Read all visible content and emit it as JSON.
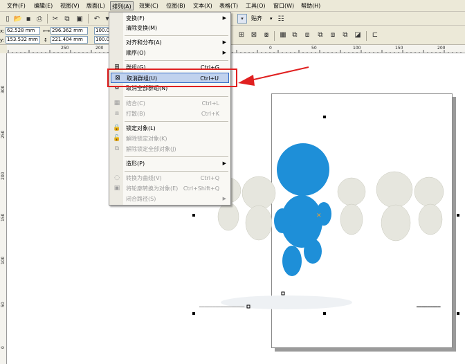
{
  "menubar": {
    "items": [
      {
        "label": "文件(F)",
        "id": "file"
      },
      {
        "label": "编辑(E)",
        "id": "edit"
      },
      {
        "label": "视图(V)",
        "id": "view"
      },
      {
        "label": "版面(L)",
        "id": "layout"
      },
      {
        "label": "排列(A)",
        "id": "arrange"
      },
      {
        "label": "效果(C)",
        "id": "effects"
      },
      {
        "label": "位图(B)",
        "id": "bitmaps"
      },
      {
        "label": "文本(X)",
        "id": "text"
      },
      {
        "label": "表格(T)",
        "id": "table"
      },
      {
        "label": "工具(O)",
        "id": "tools"
      },
      {
        "label": "窗口(W)",
        "id": "window"
      },
      {
        "label": "帮助(H)",
        "id": "help"
      }
    ]
  },
  "toolbar": {
    "snap_label": "贴齐"
  },
  "properties": {
    "x_label": "x:",
    "x_value": "62.528 mm",
    "y_label": "y:",
    "y_value": "153.532 mm",
    "width_value": "296.362 mm",
    "height_value": "221.404 mm",
    "scale_x": "100.0",
    "scale_y": "100.0"
  },
  "ruler": {
    "top_ticks": [
      "250",
      "200",
      "0",
      "50",
      "100",
      "150",
      "200"
    ],
    "left_ticks": [
      "300",
      "250",
      "200",
      "150",
      "100",
      "50",
      "0"
    ]
  },
  "arrange_menu": {
    "items": [
      {
        "label": "变换(F)",
        "shortcut": "",
        "submenu": true,
        "disabled": false,
        "icon": ""
      },
      {
        "label": "清除变换(M)",
        "shortcut": "",
        "submenu": false,
        "disabled": false,
        "icon": ""
      },
      {
        "label": "对齐和分布(A)",
        "shortcut": "",
        "submenu": true,
        "disabled": false,
        "icon": ""
      },
      {
        "label": "顺序(O)",
        "shortcut": "",
        "submenu": true,
        "disabled": false,
        "icon": ""
      },
      {
        "label": "群组(G)",
        "shortcut": "Ctrl+G",
        "submenu": false,
        "disabled": false,
        "icon": "group-icon"
      },
      {
        "label": "取消群组(U)",
        "shortcut": "Ctrl+U",
        "submenu": false,
        "disabled": false,
        "icon": "ungroup-icon"
      },
      {
        "label": "取消全部群组(N)",
        "shortcut": "",
        "submenu": false,
        "disabled": false,
        "icon": "ungroup-all-icon"
      },
      {
        "label": "结合(C)",
        "shortcut": "Ctrl+L",
        "submenu": false,
        "disabled": true,
        "icon": "combine-icon"
      },
      {
        "label": "打散(B)",
        "shortcut": "Ctrl+K",
        "submenu": false,
        "disabled": true,
        "icon": "break-apart-icon"
      },
      {
        "label": "锁定对象(L)",
        "shortcut": "",
        "submenu": false,
        "disabled": false,
        "icon": "lock-icon"
      },
      {
        "label": "解除锁定对象(K)",
        "shortcut": "",
        "submenu": false,
        "disabled": true,
        "icon": "unlock-icon"
      },
      {
        "label": "解除锁定全部对象(J)",
        "shortcut": "",
        "submenu": false,
        "disabled": true,
        "icon": "unlock-all-icon"
      },
      {
        "label": "造形(P)",
        "shortcut": "",
        "submenu": true,
        "disabled": false,
        "icon": ""
      },
      {
        "label": "转换为曲线(V)",
        "shortcut": "Ctrl+Q",
        "submenu": false,
        "disabled": true,
        "icon": "convert-curves-icon"
      },
      {
        "label": "将轮廓转换为对象(E)",
        "shortcut": "Ctrl+Shift+Q",
        "submenu": false,
        "disabled": true,
        "icon": "outline-to-object-icon"
      },
      {
        "label": "闭合路径(S)",
        "shortcut": "",
        "submenu": true,
        "disabled": true,
        "icon": ""
      }
    ],
    "highlighted_item": "取消群组(U)"
  },
  "colors": {
    "highlight": "#c1d2ee",
    "annotation_red": "#e02020",
    "figure_blue": "#1e8fd8",
    "figure_white": "#e6e6de"
  }
}
